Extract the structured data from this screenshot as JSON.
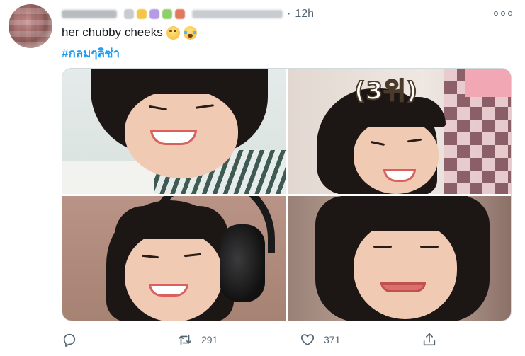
{
  "tweet": {
    "time": "12h",
    "separator": "·",
    "text": "her chubby cheeks",
    "emojis": [
      "smirking-face",
      "loudly-crying-face"
    ],
    "hashtag": "#กลมๆลิซ่า",
    "sticker_text": "(3위)",
    "reply_count": "",
    "retweet_count": "291",
    "like_count": "371"
  },
  "colors": {
    "hashtag": "#1d9bf0",
    "secondary_text": "#536471",
    "border": "#cfd9de",
    "name_emoji_squares": [
      "#c9cbd0",
      "#f3c64b",
      "#b59be6",
      "#8fcf6b",
      "#e07a5f"
    ]
  },
  "icons": {
    "more": "more-horizontal-icon",
    "reply": "reply-icon",
    "retweet": "retweet-icon",
    "like": "heart-icon",
    "share": "share-icon"
  }
}
